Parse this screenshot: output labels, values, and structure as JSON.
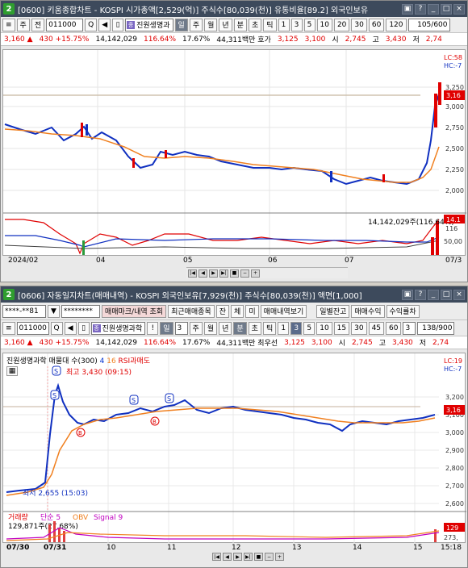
{
  "win1": {
    "num": "2",
    "title": "[0600] 키움종합차트 - KOSPI 시가총액[2,529(억)] 주식수[80,039(천)] 유통비율[89.2] 외국인보유",
    "toolbar": {
      "mode1": "주",
      "mode2": "전",
      "code": "011000",
      "stock_name": "진원생명과",
      "period_day": "일",
      "period_week": "주",
      "period_month": "월",
      "period_year": "년",
      "period_min": "분",
      "period_sec": "초",
      "period_tick": "틱",
      "intervals": [
        "1",
        "3",
        "5",
        "10",
        "20",
        "30",
        "60",
        "120"
      ],
      "page": "105/600"
    },
    "quote": {
      "price": "3,160 ▲",
      "change": "430 +15.75%",
      "volume": "14,142,029",
      "vol_ratio": "116.64%",
      "turnover": "17.67%",
      "amount": "44,311백만 호가",
      "bid": "3,125",
      "ask": "3,100",
      "open_label": "시",
      "open": "2,745",
      "high_label": "고",
      "high": "3,430",
      "low_label": "저",
      "low": "2,74"
    },
    "right_tags": {
      "lc": "LC:58",
      "hc": "HC:-7",
      "cur": "3,16",
      "vol_cur": "14.1",
      "misc1": "116",
      "misc2": "50,00"
    },
    "y_ticks": [
      "3,250",
      "3,000",
      "2,750",
      "2,500",
      "2,250",
      "2,000"
    ],
    "vol_note": "14,142,029주(116.64%)",
    "x_labels": [
      "2024/02",
      "04",
      "05",
      "06",
      "07",
      "07/3"
    ]
  },
  "win2": {
    "num": "2",
    "title": "[0606] 자동일지차트(매매내역) - KOSPI 외국인보유[7,929(천)] 주식수[80,039(천)] 액면[1,000]",
    "row1": {
      "account": "****-**81",
      "password": "********",
      "btn_trade": "매매마크/내역 조회",
      "btn_recent": "최근매매종목",
      "btn_bal": "잔",
      "btn_che": "체",
      "btn_mi": "미",
      "btn_history": "매매내역보기",
      "btn_daily": "일별잔고",
      "btn_profit": "매매수익",
      "btn_yield": "수익률차"
    },
    "toolbar": {
      "code": "011000",
      "stock_name": "진원생명과학",
      "excl": "!",
      "period_day": "일",
      "num": "3",
      "period_week": "주",
      "period_month": "월",
      "period_year": "년",
      "period_min": "분",
      "period_sec": "초",
      "period_tick": "틱",
      "intervals": [
        "1",
        "3",
        "5",
        "10",
        "15",
        "30",
        "45",
        "60"
      ],
      "num2": "3",
      "page": "138/900"
    },
    "quote": {
      "price": "3,160 ▲",
      "change": "430 +15.75%",
      "volume": "14,142,029",
      "vol_ratio": "116.64%",
      "turnover": "17.67%",
      "amount": "44,311백만 최우선",
      "bid": "3,125",
      "ask": "3,100",
      "open_label": "시",
      "open": "2,745",
      "high_label": "고",
      "high": "3,430",
      "low_label": "저",
      "low": "2,74"
    },
    "legend": {
      "name": "진원생명과학 매물대 수(300)",
      "l4": "4",
      "l16": "16",
      "rsi": "RSI과매도"
    },
    "annotations": {
      "high": "최고 3,430 (09:15)",
      "low": "최저 2,655 (15:03)"
    },
    "markers": {
      "sell": "S",
      "buy": "B"
    },
    "right_tags": {
      "lc": "LC:19",
      "hc": "HC:-7",
      "cur": "3,16",
      "vol_cur": "129",
      "misc": "273,"
    },
    "y_ticks": [
      "3,200",
      "3,100",
      "3,000",
      "2,900",
      "2,800",
      "2,700",
      "2,600"
    ],
    "vol_legend": {
      "vol": "거래량",
      "ma": "단순 5",
      "obv": "OBV",
      "signal": "Signal 9"
    },
    "vol_note": "129,871주(27.68%)",
    "x_labels": [
      "07/30",
      "07/31",
      "10",
      "11",
      "12",
      "13",
      "14",
      "15",
      "15:18"
    ]
  }
}
